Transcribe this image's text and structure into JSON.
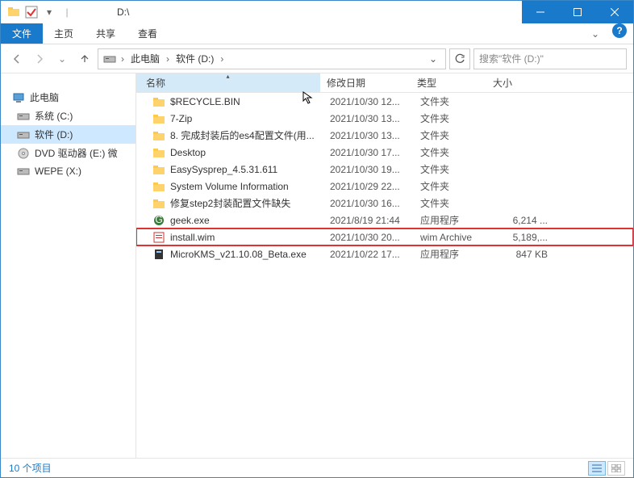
{
  "title": "D:\\",
  "ribbon": {
    "file": "文件",
    "home": "主页",
    "share": "共享",
    "view": "查看"
  },
  "breadcrumb": {
    "root": "此电脑",
    "location": "软件 (D:)"
  },
  "search": {
    "placeholder": "搜索\"软件 (D:)\""
  },
  "nav": {
    "pc": "此电脑",
    "items": [
      {
        "label": "系统 (C:)",
        "icon": "drive"
      },
      {
        "label": "软件 (D:)",
        "icon": "drive",
        "selected": true
      },
      {
        "label": "DVD 驱动器 (E:) 微",
        "icon": "dvd"
      },
      {
        "label": "WEPE (X:)",
        "icon": "drive"
      }
    ]
  },
  "columns": {
    "name": "名称",
    "date": "修改日期",
    "type": "类型",
    "size": "大小"
  },
  "files": [
    {
      "name": "$RECYCLE.BIN",
      "date": "2021/10/30 12...",
      "type": "文件夹",
      "size": "",
      "icon": "folder"
    },
    {
      "name": "7-Zip",
      "date": "2021/10/30 13...",
      "type": "文件夹",
      "size": "",
      "icon": "folder"
    },
    {
      "name": "8. 完成封装后的es4配置文件(用...",
      "date": "2021/10/30 13...",
      "type": "文件夹",
      "size": "",
      "icon": "folder"
    },
    {
      "name": "Desktop",
      "date": "2021/10/30 17...",
      "type": "文件夹",
      "size": "",
      "icon": "folder"
    },
    {
      "name": "EasySysprep_4.5.31.611",
      "date": "2021/10/30 19...",
      "type": "文件夹",
      "size": "",
      "icon": "folder"
    },
    {
      "name": "System Volume Information",
      "date": "2021/10/29 22...",
      "type": "文件夹",
      "size": "",
      "icon": "folder"
    },
    {
      "name": "修复step2封装配置文件缺失",
      "date": "2021/10/30 16...",
      "type": "文件夹",
      "size": "",
      "icon": "folder"
    },
    {
      "name": "geek.exe",
      "date": "2021/8/19 21:44",
      "type": "应用程序",
      "size": "6,214 ...",
      "icon": "geek"
    },
    {
      "name": "install.wim",
      "date": "2021/10/30 20...",
      "type": "wim Archive",
      "size": "5,189,...",
      "icon": "wim",
      "highlighted": true
    },
    {
      "name": "MicroKMS_v21.10.08_Beta.exe",
      "date": "2021/10/22 17...",
      "type": "应用程序",
      "size": "847 KB",
      "icon": "exe"
    }
  ],
  "status": {
    "count": "10 个项目"
  }
}
